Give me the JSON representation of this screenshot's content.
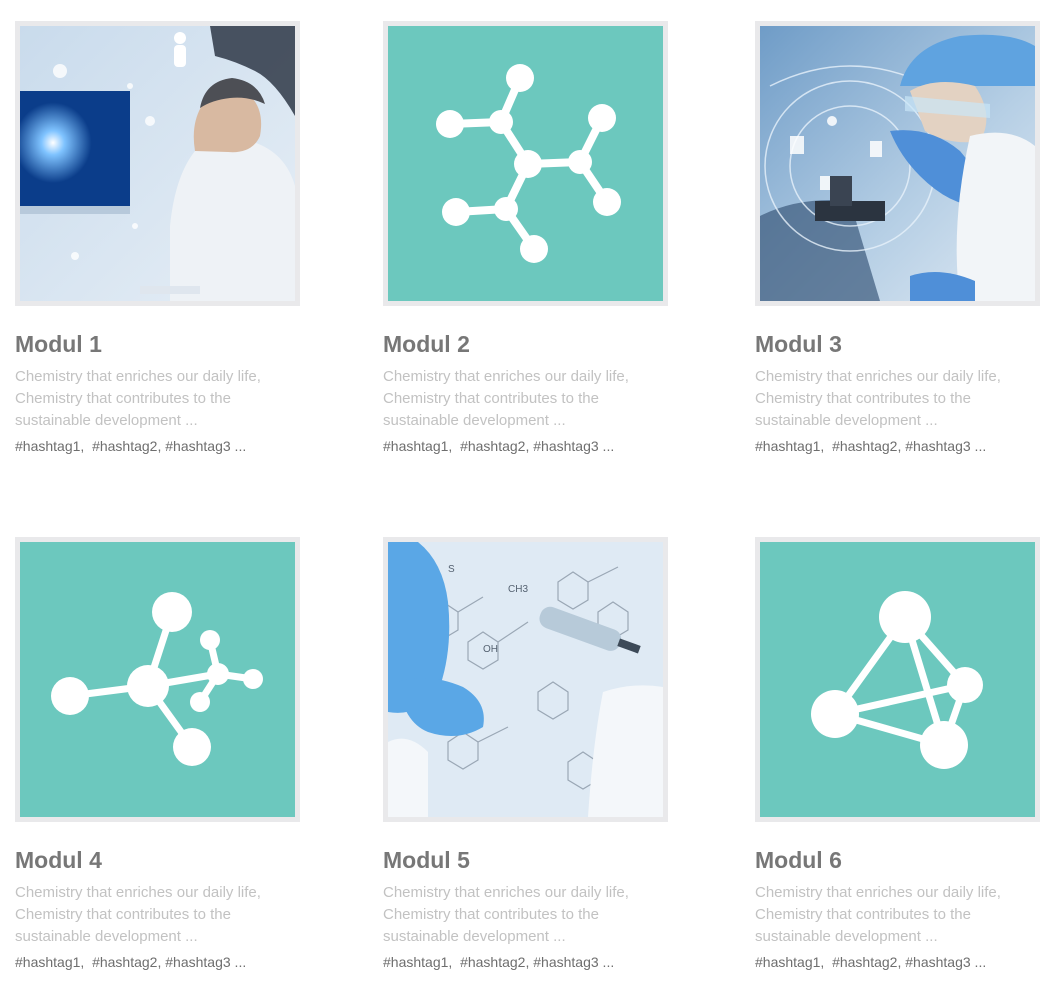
{
  "colors": {
    "teal": "#6cc8be",
    "frame": "#e9e9eb",
    "title": "#777777",
    "description": "#c2c2c2",
    "hashtags": "#6e6e6e"
  },
  "modules": [
    {
      "title": "Modul 1",
      "image": "scientist-at-monitor-photo",
      "desc": [
        "Chemistry that enriches our daily life,",
        "Chemistry that contributes to the",
        "sustainable development ..."
      ],
      "tags": [
        "#hashtag1,",
        "#hashtag2,",
        "#hashtag3 ..."
      ]
    },
    {
      "title": "Modul 2",
      "image": "molecule-icon",
      "desc": [
        "Chemistry that enriches our daily life,",
        "Chemistry that contributes to the",
        "sustainable development ..."
      ],
      "tags": [
        "#hashtag1,",
        "#hashtag2,",
        "#hashtag3 ..."
      ]
    },
    {
      "title": "Modul 3",
      "image": "scientist-microscope-photo",
      "desc": [
        "Chemistry that enriches our daily life,",
        "Chemistry that contributes to the",
        "sustainable development ..."
      ],
      "tags": [
        "#hashtag1,",
        "#hashtag2,",
        "#hashtag3 ..."
      ]
    },
    {
      "title": "Modul 4",
      "image": "molecule-icon",
      "desc": [
        "Chemistry that enriches our daily life,",
        "Chemistry that contributes to the",
        "sustainable development ..."
      ],
      "tags": [
        "#hashtag1,",
        "#hashtag2,",
        "#hashtag3 ..."
      ]
    },
    {
      "title": "Modul 5",
      "image": "pipette-formula-photo",
      "desc": [
        "Chemistry that enriches our daily life,",
        "Chemistry that contributes to the",
        "sustainable development ..."
      ],
      "tags": [
        "#hashtag1,",
        "#hashtag2,",
        "#hashtag3 ..."
      ]
    },
    {
      "title": "Modul 6",
      "image": "tetrahedron-molecule-icon",
      "desc": [
        "Chemistry that enriches our daily life,",
        "Chemistry that contributes to the",
        "sustainable development ..."
      ],
      "tags": [
        "#hashtag1,",
        "#hashtag2,",
        "#hashtag3 ..."
      ]
    }
  ]
}
